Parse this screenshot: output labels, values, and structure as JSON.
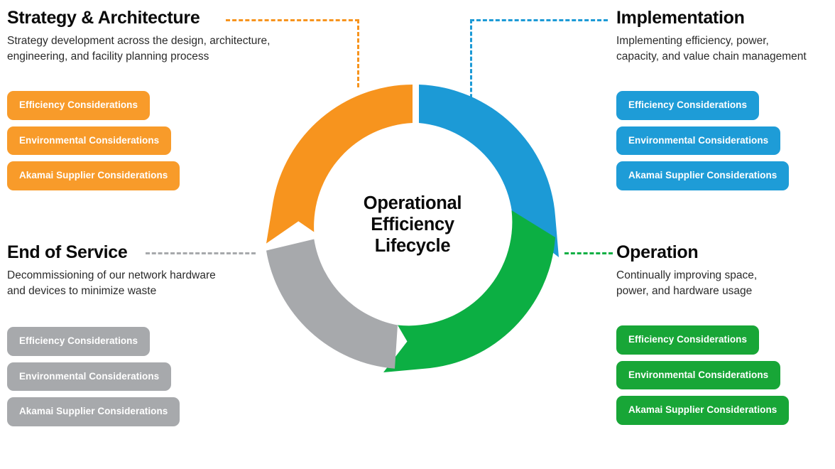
{
  "center": {
    "line1": "Operational",
    "line2": "Efficiency",
    "line3": "Lifecycle"
  },
  "colors": {
    "orange_ring": "#F7941E",
    "blue_ring": "#1C9AD6",
    "green_ring": "#0CAF43",
    "gray_ring": "#A7A9AC",
    "orange_pill": "#F89B2A",
    "blue_pill": "#1E9CD7",
    "green_pill": "#18A637",
    "gray_pill": "#A7A9AC",
    "title_text": "#0A0A0A",
    "body_text": "#2B2B2B",
    "pill_text": "#FFFFFF",
    "background": "#FFFFFF"
  },
  "quadrants": [
    {
      "id": "strategy-architecture",
      "title": "Strategy & Architecture",
      "description_line1": "Strategy development across the design, architecture,",
      "description_line2": "engineering, and facility planning process",
      "accent": "#F7941E",
      "pill_color": "#F89B2A",
      "pills": [
        "Efficiency Considerations",
        "Environmental Considerations",
        "Akamai Supplier Considerations"
      ]
    },
    {
      "id": "implementation",
      "title": "Implementation",
      "description_line1": "Implementing efficiency, power,",
      "description_line2": "capacity, and value chain management",
      "accent": "#1C9AD6",
      "pill_color": "#1E9CD7",
      "pills": [
        "Efficiency Considerations",
        "Environmental Considerations",
        "Akamai Supplier Considerations"
      ]
    },
    {
      "id": "operation",
      "title": "Operation",
      "description_line1": "Continually improving space,",
      "description_line2": "power, and hardware usage",
      "accent": "#0CAF43",
      "pill_color": "#18A637",
      "pills": [
        "Efficiency Considerations",
        "Environmental Considerations",
        "Akamai Supplier Considerations"
      ]
    },
    {
      "id": "end-of-service",
      "title": "End of Service",
      "description_line1": "Decommissioning of our network hardware",
      "description_line2": "and devices to minimize waste",
      "accent": "#A7A9AC",
      "pill_color": "#A7A9AC",
      "pills": [
        "Efficiency Considerations",
        "Environmental Considerations",
        "Akamai Supplier Considerations"
      ]
    }
  ],
  "chart_data": {
    "type": "pie",
    "title": "Operational Efficiency Lifecycle",
    "categories": [
      "Strategy & Architecture",
      "Implementation",
      "Operation",
      "End of Service"
    ],
    "values": [
      25,
      25,
      25,
      25
    ],
    "colors": [
      "#F7941E",
      "#1C9AD6",
      "#0CAF43",
      "#A7A9AC"
    ],
    "legend": "none",
    "note": "Four-segment cyclical arrow donut, each segment a 90-degree arrow pointing clockwise"
  }
}
